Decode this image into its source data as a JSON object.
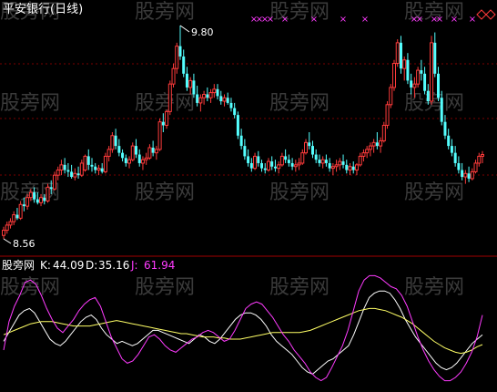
{
  "header": {
    "title": "平安银行(日线)"
  },
  "colors": {
    "background": "#000000",
    "up_candle": "#ff3b3b",
    "down_candle": "#54ffff",
    "grid": "#7a0000",
    "separator": "#a00000",
    "title_text": "#ffffff",
    "marker": "#ff3bff",
    "k_line": "#ffffff",
    "d_line": "#ffff66",
    "j_line": "#ff3bff",
    "watermark": "#3a3a3a"
  },
  "watermark_text": "股旁网",
  "price_panel": {
    "high_label": "9.80",
    "low_label": "8.56",
    "top_markers": "×",
    "corner_icon": "diamond-icon"
  },
  "kdj_panel": {
    "name": "股旁网",
    "k_label": "K:",
    "k_value": "44.09",
    "d_label": "D:",
    "d_value": "35.16",
    "j_label": "J:",
    "j_value": "61.94"
  },
  "chart_data": [
    {
      "type": "candlestick",
      "series_name": "平安银行(日线)",
      "ylim": [
        8.56,
        9.8
      ],
      "grid": true,
      "annotations": [
        {
          "text": "9.80",
          "index": 52
        },
        {
          "text": "8.56",
          "index": 0
        }
      ],
      "ohlc": [
        [
          8.58,
          8.63,
          8.56,
          8.61
        ],
        [
          8.61,
          8.66,
          8.59,
          8.64
        ],
        [
          8.64,
          8.68,
          8.62,
          8.66
        ],
        [
          8.66,
          8.72,
          8.64,
          8.7
        ],
        [
          8.7,
          8.74,
          8.67,
          8.68
        ],
        [
          8.68,
          8.78,
          8.67,
          8.76
        ],
        [
          8.76,
          8.8,
          8.72,
          8.75
        ],
        [
          8.75,
          8.82,
          8.73,
          8.8
        ],
        [
          8.8,
          8.85,
          8.78,
          8.83
        ],
        [
          8.83,
          8.86,
          8.77,
          8.79
        ],
        [
          8.79,
          8.83,
          8.76,
          8.77
        ],
        [
          8.77,
          8.82,
          8.75,
          8.8
        ],
        [
          8.8,
          8.82,
          8.76,
          8.78
        ],
        [
          8.78,
          8.88,
          8.77,
          8.86
        ],
        [
          8.86,
          8.9,
          8.82,
          8.85
        ],
        [
          8.85,
          8.95,
          8.84,
          8.93
        ],
        [
          8.93,
          8.98,
          8.9,
          8.96
        ],
        [
          8.96,
          9.02,
          8.93,
          8.99
        ],
        [
          8.99,
          9.03,
          8.94,
          8.96
        ],
        [
          8.96,
          9.0,
          8.92,
          8.95
        ],
        [
          8.95,
          8.99,
          8.91,
          8.92
        ],
        [
          8.92,
          8.97,
          8.9,
          8.94
        ],
        [
          8.94,
          8.98,
          8.91,
          8.93
        ],
        [
          8.93,
          9.02,
          8.92,
          9.0
        ],
        [
          8.96,
          9.05,
          8.95,
          9.04
        ],
        [
          9.04,
          9.08,
          8.96,
          8.99
        ],
        [
          8.99,
          9.03,
          8.95,
          8.98
        ],
        [
          8.98,
          9.0,
          8.94,
          8.96
        ],
        [
          8.96,
          8.99,
          8.93,
          8.97
        ],
        [
          8.97,
          9.0,
          8.94,
          8.95
        ],
        [
          8.95,
          9.06,
          8.94,
          9.04
        ],
        [
          9.04,
          9.1,
          9.01,
          9.08
        ],
        [
          9.08,
          9.18,
          9.06,
          9.16
        ],
        [
          9.16,
          9.2,
          9.08,
          9.1
        ],
        [
          9.1,
          9.14,
          9.04,
          9.06
        ],
        [
          9.06,
          9.08,
          9.01,
          9.03
        ],
        [
          9.03,
          9.05,
          8.98,
          9.0
        ],
        [
          9.0,
          9.04,
          8.97,
          9.02
        ],
        [
          9.02,
          9.12,
          9.01,
          9.1
        ],
        [
          9.1,
          9.14,
          9.03,
          9.05
        ],
        [
          9.05,
          9.08,
          8.98,
          9.0
        ],
        [
          9.0,
          9.04,
          8.96,
          9.02
        ],
        [
          9.02,
          9.06,
          8.99,
          9.03
        ],
        [
          9.03,
          9.11,
          9.02,
          9.09
        ],
        [
          9.09,
          9.13,
          9.04,
          9.06
        ],
        [
          9.06,
          9.1,
          9.02,
          9.08
        ],
        [
          9.08,
          9.26,
          9.07,
          9.24
        ],
        [
          9.24,
          9.29,
          9.18,
          9.22
        ],
        [
          9.22,
          9.31,
          9.2,
          9.3
        ],
        [
          9.3,
          9.48,
          9.28,
          9.46
        ],
        [
          9.46,
          9.58,
          9.44,
          9.55
        ],
        [
          9.55,
          9.7,
          9.52,
          9.68
        ],
        [
          9.68,
          9.8,
          9.6,
          9.62
        ],
        [
          9.62,
          9.66,
          9.5,
          9.52
        ],
        [
          9.52,
          9.56,
          9.42,
          9.44
        ],
        [
          9.44,
          9.5,
          9.4,
          9.48
        ],
        [
          9.48,
          9.52,
          9.38,
          9.4
        ],
        [
          9.4,
          9.45,
          9.33,
          9.35
        ],
        [
          9.35,
          9.4,
          9.3,
          9.38
        ],
        [
          9.38,
          9.42,
          9.34,
          9.4
        ],
        [
          9.4,
          9.44,
          9.36,
          9.38
        ],
        [
          9.38,
          9.43,
          9.35,
          9.41
        ],
        [
          9.41,
          9.46,
          9.38,
          9.43
        ],
        [
          9.43,
          9.46,
          9.37,
          9.39
        ],
        [
          9.39,
          9.42,
          9.34,
          9.36
        ],
        [
          9.36,
          9.4,
          9.33,
          9.38
        ],
        [
          9.38,
          9.41,
          9.34,
          9.35
        ],
        [
          9.35,
          9.38,
          9.3,
          9.32
        ],
        [
          9.32,
          9.35,
          9.26,
          9.28
        ],
        [
          9.28,
          9.3,
          9.14,
          9.16
        ],
        [
          9.16,
          9.2,
          9.08,
          9.1
        ],
        [
          9.1,
          9.14,
          9.02,
          9.04
        ],
        [
          9.04,
          9.08,
          8.98,
          9.0
        ],
        [
          9.0,
          9.03,
          8.95,
          8.97
        ],
        [
          8.97,
          9.06,
          8.96,
          9.04
        ],
        [
          9.04,
          9.07,
          8.98,
          9.0
        ],
        [
          9.0,
          9.02,
          8.95,
          8.97
        ],
        [
          8.97,
          9.0,
          8.94,
          8.96
        ],
        [
          8.96,
          9.03,
          8.95,
          9.01
        ],
        [
          9.01,
          9.04,
          8.96,
          8.98
        ],
        [
          8.98,
          9.02,
          8.95,
          8.97
        ],
        [
          8.97,
          9.01,
          8.94,
          8.99
        ],
        [
          8.99,
          9.06,
          8.98,
          9.04
        ],
        [
          9.04,
          9.08,
          9.0,
          9.02
        ],
        [
          9.02,
          9.05,
          8.98,
          9.0
        ],
        [
          9.0,
          9.03,
          8.96,
          8.98
        ],
        [
          8.98,
          9.02,
          8.95,
          8.99
        ],
        [
          8.99,
          9.03,
          8.96,
          9.0
        ],
        [
          9.0,
          9.08,
          8.99,
          9.06
        ],
        [
          9.06,
          9.14,
          9.05,
          9.12
        ],
        [
          9.12,
          9.18,
          9.08,
          9.1
        ],
        [
          9.1,
          9.13,
          9.03,
          9.05
        ],
        [
          9.05,
          9.08,
          9.0,
          9.02
        ],
        [
          9.02,
          9.05,
          8.98,
          9.0
        ],
        [
          9.0,
          9.04,
          8.97,
          9.02
        ],
        [
          9.02,
          9.05,
          8.98,
          9.0
        ],
        [
          9.0,
          9.03,
          8.95,
          8.97
        ],
        [
          8.97,
          9.0,
          8.93,
          8.98
        ],
        [
          8.98,
          9.02,
          8.95,
          8.99
        ],
        [
          8.99,
          9.03,
          8.96,
          9.01
        ],
        [
          9.01,
          9.05,
          8.97,
          8.99
        ],
        [
          8.99,
          9.02,
          8.94,
          8.96
        ],
        [
          8.96,
          9.0,
          8.93,
          8.98
        ],
        [
          8.98,
          9.01,
          8.94,
          8.96
        ],
        [
          8.96,
          9.0,
          8.93,
          8.99
        ],
        [
          8.99,
          9.06,
          8.98,
          9.04
        ],
        [
          9.04,
          9.08,
          9.01,
          9.06
        ],
        [
          9.06,
          9.1,
          9.03,
          9.08
        ],
        [
          9.08,
          9.12,
          9.04,
          9.1
        ],
        [
          9.1,
          9.14,
          9.06,
          9.12
        ],
        [
          9.12,
          9.18,
          9.08,
          9.1
        ],
        [
          9.1,
          9.15,
          9.06,
          9.13
        ],
        [
          9.13,
          9.24,
          9.12,
          9.22
        ],
        [
          9.22,
          9.36,
          9.2,
          9.34
        ],
        [
          9.34,
          9.46,
          9.32,
          9.44
        ],
        [
          9.44,
          9.6,
          9.42,
          9.58
        ],
        [
          9.58,
          9.72,
          9.56,
          9.7
        ],
        [
          9.7,
          9.74,
          9.52,
          9.55
        ],
        [
          9.55,
          9.62,
          9.48,
          9.6
        ],
        [
          9.6,
          9.64,
          9.46,
          9.48
        ],
        [
          9.48,
          9.52,
          9.4,
          9.44
        ],
        [
          9.44,
          9.5,
          9.38,
          9.46
        ],
        [
          9.46,
          9.56,
          9.44,
          9.54
        ],
        [
          9.54,
          9.6,
          9.48,
          9.52
        ],
        [
          9.52,
          9.56,
          9.4,
          9.42
        ],
        [
          9.42,
          9.46,
          9.34,
          9.36
        ],
        [
          9.36,
          9.74,
          9.34,
          9.7
        ],
        [
          9.7,
          9.76,
          9.5,
          9.52
        ],
        [
          9.52,
          9.56,
          9.36,
          9.38
        ],
        [
          9.38,
          9.42,
          9.22,
          9.24
        ],
        [
          9.24,
          9.28,
          9.14,
          9.16
        ],
        [
          9.16,
          9.2,
          9.08,
          9.1
        ],
        [
          9.1,
          9.14,
          9.04,
          9.06
        ],
        [
          9.06,
          9.1,
          8.98,
          9.0
        ],
        [
          9.0,
          9.04,
          8.94,
          8.96
        ],
        [
          8.96,
          9.0,
          8.9,
          8.92
        ],
        [
          8.92,
          8.96,
          8.88,
          8.94
        ],
        [
          8.94,
          8.98,
          8.89,
          8.91
        ],
        [
          8.91,
          8.97,
          8.9,
          8.95
        ],
        [
          8.95,
          9.02,
          8.94,
          9.0
        ],
        [
          9.0,
          9.06,
          8.98,
          9.04
        ],
        [
          9.04,
          9.07,
          9.0,
          9.05
        ]
      ]
    },
    {
      "type": "line",
      "series": [
        {
          "name": "K",
          "values": [
            38,
            46,
            54,
            62,
            66,
            68,
            64,
            56,
            48,
            40,
            36,
            34,
            38,
            44,
            50,
            56,
            60,
            62,
            58,
            50,
            44,
            40,
            36,
            38,
            36,
            34,
            36,
            40,
            44,
            48,
            48,
            46,
            44,
            42,
            40,
            38,
            36,
            40,
            44,
            42,
            38,
            36,
            40,
            46,
            52,
            58,
            62,
            64,
            64,
            62,
            58,
            52,
            44,
            38,
            34,
            30,
            26,
            20,
            14,
            10,
            8,
            12,
            16,
            20,
            22,
            26,
            30,
            34,
            44,
            56,
            68,
            78,
            82,
            84,
            84,
            82,
            76,
            68,
            58,
            50,
            42,
            36,
            30,
            24,
            18,
            14,
            12,
            14,
            18,
            24,
            30,
            36,
            40,
            44
          ]
        },
        {
          "name": "D",
          "values": [
            44,
            46,
            48,
            50,
            52,
            54,
            55,
            56,
            56,
            56,
            55,
            54,
            53,
            52,
            52,
            52,
            52,
            53,
            54,
            55,
            56,
            57,
            56,
            55,
            54,
            53,
            52,
            51,
            50,
            49,
            48,
            47,
            46,
            45,
            45,
            44,
            43,
            42,
            42,
            42,
            41,
            41,
            40,
            40,
            40,
            41,
            42,
            43,
            44,
            45,
            46,
            46,
            46,
            46,
            46,
            46,
            47,
            48,
            50,
            52,
            54,
            56,
            58,
            60,
            62,
            64,
            66,
            67,
            68,
            68,
            67,
            66,
            64,
            62,
            60,
            57,
            54,
            50,
            46,
            42,
            38,
            35,
            32,
            30,
            28,
            27,
            28,
            30,
            33,
            35
          ]
        },
        {
          "name": "J",
          "values": [
            30,
            56,
            70,
            80,
            92,
            94,
            90,
            80,
            68,
            58,
            50,
            46,
            52,
            58,
            66,
            72,
            76,
            78,
            70,
            56,
            42,
            32,
            22,
            18,
            20,
            26,
            34,
            42,
            44,
            40,
            34,
            30,
            28,
            32,
            36,
            40,
            42,
            46,
            48,
            46,
            42,
            38,
            40,
            48,
            58,
            68,
            72,
            74,
            72,
            66,
            60,
            52,
            44,
            38,
            30,
            24,
            18,
            10,
            5,
            2,
            5,
            14,
            24,
            34,
            48,
            66,
            84,
            94,
            98,
            98,
            96,
            92,
            88,
            86,
            80,
            70,
            56,
            42,
            30,
            20,
            12,
            6,
            2,
            2,
            5,
            10,
            18,
            28,
            42,
            62
          ]
        }
      ],
      "ylim": [
        0,
        100
      ]
    }
  ]
}
